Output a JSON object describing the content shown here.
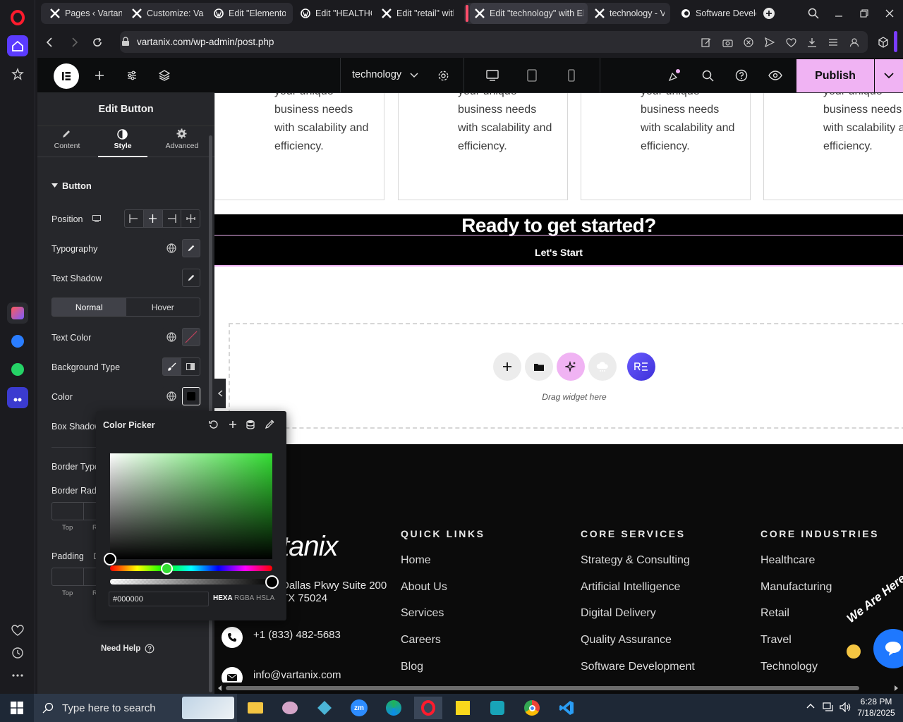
{
  "browser": {
    "tabs": [
      {
        "label": "Pages ‹ Vartanix",
        "icon": "elementor-x-icon"
      },
      {
        "label": "Customize: Vartanix",
        "icon": "elementor-x-icon"
      },
      {
        "label": "Edit \"Elementor",
        "icon": "wordpress-icon"
      },
      {
        "label": "Edit \"HEALTHCARE",
        "icon": "wordpress-icon"
      },
      {
        "label": "Edit \"retail\" with",
        "icon": "elementor-x-icon"
      },
      {
        "label": "Edit \"technology\" with Elementor",
        "icon": "elementor-x-icon"
      },
      {
        "label": "technology - Vartanix",
        "icon": "elementor-x-icon"
      },
      {
        "label": "Software Development",
        "icon": "site-c-icon"
      }
    ],
    "url": "vartanix.com/wp-admin/post.php"
  },
  "editor_top": {
    "page_name": "technology",
    "publish_label": "Publish"
  },
  "panel": {
    "title": "Edit Button",
    "tabs": [
      {
        "label": "Content",
        "icon": "pencil-icon"
      },
      {
        "label": "Style",
        "icon": "half-circle-icon"
      },
      {
        "label": "Advanced",
        "icon": "gear-icon"
      }
    ],
    "section": "Button",
    "position_label": "Position",
    "typography_label": "Typography",
    "text_shadow_label": "Text Shadow",
    "state_normal": "Normal",
    "state_hover": "Hover",
    "text_color_label": "Text Color",
    "background_type_label": "Background Type",
    "color_label": "Color",
    "box_shadow_label": "Box Shadow",
    "border_type_label": "Border Type",
    "border_radius_label": "Border Radi",
    "top_label": "Top",
    "r_label": "R",
    "padding_label": "Padding",
    "padding_d": "D",
    "need_help": "Need Help"
  },
  "color_picker": {
    "title": "Color Picker",
    "value": "#000000",
    "formats": [
      "HEXA",
      "RGBA",
      "HSLA"
    ],
    "hue_fraction": 0.35
  },
  "canvas": {
    "card_text": [
      "your unique",
      "business needs",
      "with scalability and",
      "efficiency."
    ],
    "card_text_last_col": [
      "your unique",
      "business needs",
      "with scalability a",
      "efficiency."
    ],
    "cta_heading": "Ready to get started?",
    "cta_button": "Let's Start",
    "drag_widget": "Drag widget here",
    "footer": {
      "logo_text": "tanix",
      "address_line1": "Dallas Pkwy Suite 200",
      "address_line2": "TX 75024",
      "phone": "+1 (833) 482-5683",
      "email": "info@vartanix.com",
      "quick_links_title": "QUICK LINKS",
      "quick_links": [
        "Home",
        "About Us",
        "Services",
        "Careers",
        "Blog"
      ],
      "core_services_title": "CORE SERVICES",
      "core_services": [
        "Strategy & Consulting",
        "Artificial Intelligence",
        "Digital Delivery",
        "Quality Assurance",
        "Software Development"
      ],
      "core_industries_title": "CORE INDUSTRIES",
      "core_industries": [
        "Healthcare",
        "Manufacturing",
        "Retail",
        "Travel",
        "Technology"
      ],
      "chat_badge": "We Are Here"
    }
  },
  "taskbar": {
    "search_placeholder": "Type here to search",
    "time": "6:28 PM",
    "date": "7/18/2025"
  },
  "colors": {
    "accent_pink": "#f0b3f3",
    "elementor_bg": "#0c0d0e",
    "panel_bg": "#26272b",
    "picker_green": "#33dd33",
    "opera_red": "#ff1b2d"
  }
}
